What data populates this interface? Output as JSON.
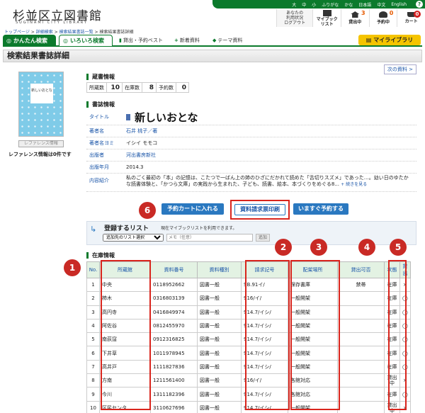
{
  "header": {
    "logo_ja": "杉並区立図書館",
    "logo_en": "SUGINAMI CITY LIBRARY",
    "top_links": [
      "大",
      "中",
      "小",
      "ふりがな",
      "かな",
      "日本語",
      "中文",
      "English"
    ],
    "help": "?",
    "user_nav": [
      {
        "label": "あなたの\n利用状況\nログアウト",
        "count": ""
      },
      {
        "label": "マイブック\nリスト",
        "count": ""
      },
      {
        "label": "貸出中",
        "count": "3"
      },
      {
        "label": "予約中",
        "count": "0"
      },
      {
        "label": "カート",
        "count": "0"
      }
    ]
  },
  "breadcrumb": [
    "トップページ",
    "詳細検索",
    "検索結果書誌一覧",
    "検索結果書誌詳細"
  ],
  "tabs": {
    "easy": "かんたん検索",
    "various": "いろいろ検索",
    "sub": [
      "貸出・予約ベスト",
      "新着資料",
      "テーマ資料"
    ],
    "mylib": "マイライブラリ"
  },
  "page_title": "検索結果書誌詳細",
  "next_label": "次の資料 >",
  "cover": {
    "label": "新しいおとな"
  },
  "reference_button": "レファレンス情報",
  "reference_info": "レファレンス情報は0件です",
  "holdings": {
    "section": "蔵書情報",
    "items": [
      {
        "label": "所蔵数",
        "value": "10"
      },
      {
        "label": "在庫数",
        "value": "8"
      },
      {
        "label": "予約数",
        "value": "0"
      }
    ]
  },
  "biblio": {
    "section": "書誌情報",
    "title_label": "タイトル",
    "title": "新しいおとな",
    "rows": [
      {
        "k": "著者名",
        "v": "石井 桃子／著",
        "link": true
      },
      {
        "k": "著者名ヨミ",
        "v": "イシイ モモコ",
        "link": false
      },
      {
        "k": "出版者",
        "v": "河出書房新社",
        "link": true
      },
      {
        "k": "出版年月",
        "v": "2014.3",
        "link": false
      },
      {
        "k": "内容紹介",
        "v": "私のごく最初の「本」の記憶は、こたつで一ばん上の姉のひざにだかれて読めた「舌切りスズメ」であった…。幼い日のゆたかな読書体験と、「かつら文庫」の実践から生まれた、子ども、読書、絵本、本づくりをめぐる8...",
        "more": "+ 続きを見る",
        "link": false
      }
    ]
  },
  "actions": {
    "cart": "予約カートに入れる",
    "print": "資料請求票印刷",
    "reserve": "いますぐ予約する"
  },
  "list_register": {
    "title": "登録するリスト",
    "desc": "現在マイブックリストを利用できます。",
    "select": "追加先のリスト選択",
    "memo_placeholder": "メモ（任意）",
    "add": "追加"
  },
  "availability": {
    "section": "在庫情報",
    "headers": [
      "No.",
      "所蔵館",
      "資料番号",
      "資料種別",
      "請求記号",
      "配架場所",
      "貸出可否",
      "状態",
      "貸出"
    ],
    "rows": [
      [
        "1",
        "中央",
        "0118952662",
        "図書一般",
        "SB.91イ/",
        "保存書庫",
        "禁帯",
        "在庫",
        "×"
      ],
      [
        "2",
        "柿木",
        "0316803139",
        "図書一般",
        "916/イ/",
        "一般開架",
        "",
        "在庫",
        "◯"
      ],
      [
        "3",
        "高円寺",
        "0416849974",
        "図書一般",
        "914.7/イシ/",
        "一般開架",
        "",
        "在庫",
        "◯"
      ],
      [
        "4",
        "阿佐谷",
        "0812455970",
        "図書一般",
        "914.7/イシ/",
        "一般開架",
        "",
        "在庫",
        "◯"
      ],
      [
        "5",
        "南荻窪",
        "0912316825",
        "図書一般",
        "914.7/イシ/",
        "一般開架",
        "",
        "在庫",
        "◯"
      ],
      [
        "6",
        "下井草",
        "1011978945",
        "図書一般",
        "914.7/イシ/",
        "一般開架",
        "",
        "在庫",
        "◯"
      ],
      [
        "7",
        "高井戸",
        "1111827836",
        "図書一般",
        "914.7/イシ/",
        "一般開架",
        "",
        "在庫",
        "◯"
      ],
      [
        "8",
        "方南",
        "1211561400",
        "図書一般",
        "916/イ/",
        "各館対応",
        "",
        "貸出中",
        "×"
      ],
      [
        "9",
        "今川",
        "1311182396",
        "図書一般",
        "914.7/イシ/",
        "各館対応",
        "",
        "在庫",
        "◯"
      ],
      [
        "10",
        "区民センタ",
        "3110627696",
        "図書一般",
        "914.7/イシ/",
        "一般開架",
        "",
        "貸出中",
        "×"
      ]
    ]
  },
  "markers": [
    "1",
    "2",
    "3",
    "4",
    "5",
    "6"
  ],
  "colors": {
    "brand": "#0b7a2c",
    "accent_red": "#d9251d",
    "button_blue": "#2a78c0",
    "mylib_yellow": "#f5c400"
  }
}
